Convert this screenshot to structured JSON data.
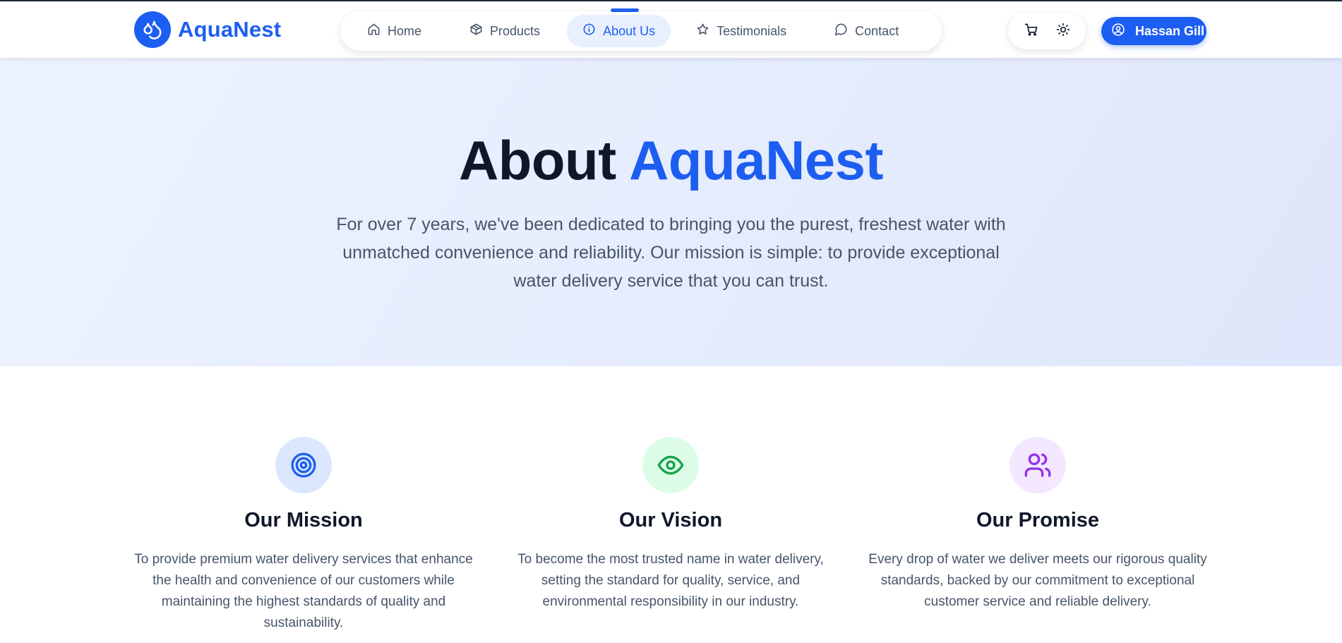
{
  "brand": {
    "name": "AquaNest",
    "logo_icon": "water-drops-icon",
    "color": "#1d5ef2"
  },
  "nav": {
    "items": [
      {
        "label": "Home",
        "icon": "home-icon",
        "active": false
      },
      {
        "label": "Products",
        "icon": "package-icon",
        "active": false
      },
      {
        "label": "About Us",
        "icon": "info-icon",
        "active": true
      },
      {
        "label": "Testimonials",
        "icon": "star-icon",
        "active": false
      },
      {
        "label": "Contact",
        "icon": "chat-bubble-icon",
        "active": false
      }
    ]
  },
  "utilities": {
    "cart_icon": "cart-icon",
    "theme_icon": "sun-icon"
  },
  "user": {
    "name": "Hassan Gill",
    "icon": "user-circle-icon"
  },
  "hero": {
    "title_prefix": "About",
    "title_accent": "AquaNest",
    "text": "For over 7 years, we've been dedicated to bringing you the purest, freshest water with unmatched convenience and reliability. Our mission is simple: to provide exceptional water delivery service that you can trust."
  },
  "values": [
    {
      "title": "Our Mission",
      "icon": "target-icon",
      "icon_color": "#1d5ef2",
      "icon_bg": "#dbe7fd",
      "text": "To provide premium water delivery services that enhance the health and convenience of our customers while maintaining the highest standards of quality and sustainability."
    },
    {
      "title": "Our Vision",
      "icon": "eye-icon",
      "icon_color": "#16a34a",
      "icon_bg": "#dcfce7",
      "text": "To become the most trusted name in water delivery, setting the standard for quality, service, and environmental responsibility in our industry."
    },
    {
      "title": "Our Promise",
      "icon": "users-icon",
      "icon_color": "#9333ea",
      "icon_bg": "#f3e8ff",
      "text": "Every drop of water we deliver meets our rigorous quality standards, backed by our commitment to exceptional customer service and reliable delivery."
    }
  ]
}
